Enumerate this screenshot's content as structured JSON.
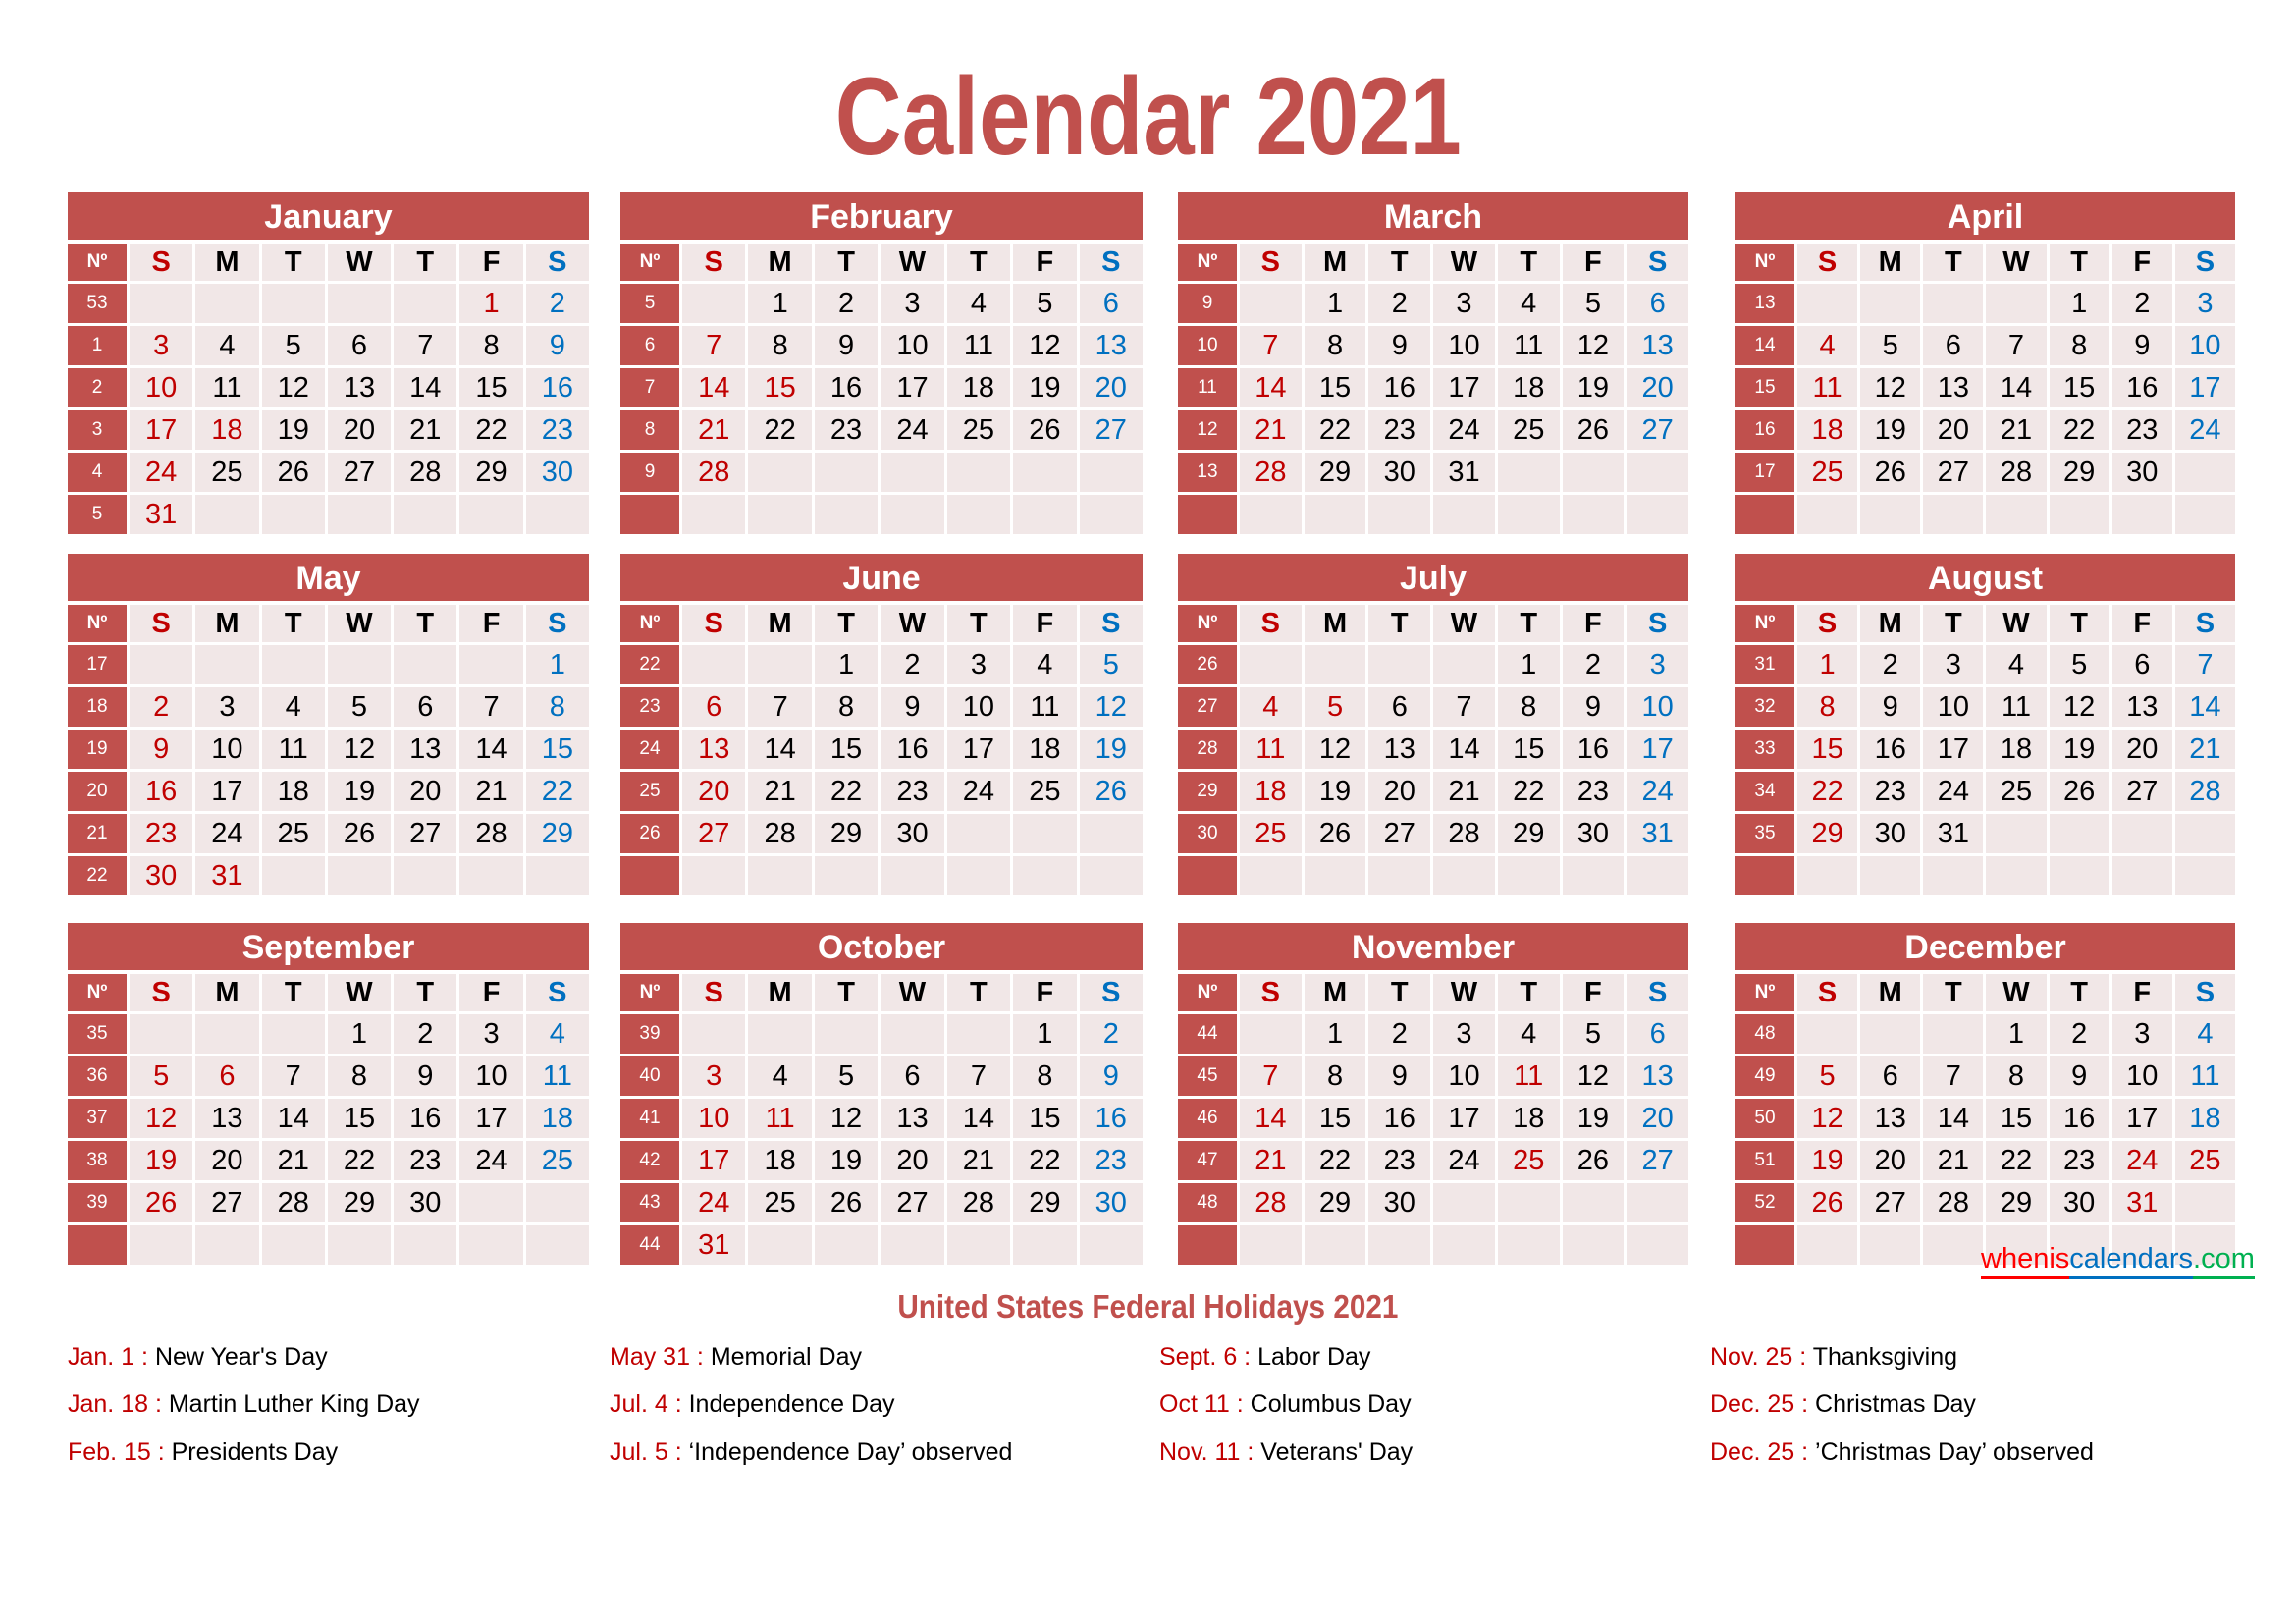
{
  "title": "Calendar 2021",
  "colors": {
    "accent": "#c0504d",
    "sunday": "#c00000",
    "saturday": "#0070c0",
    "holiday": "#c00000",
    "cell_bg": "#f1e7e7"
  },
  "week_label": "Nº",
  "weekdays": [
    "S",
    "M",
    "T",
    "W",
    "T",
    "F",
    "S"
  ],
  "months": [
    {
      "name": "January",
      "start": 5,
      "days": 31,
      "weeks": [
        "53",
        "1",
        "2",
        "3",
        "4",
        "5"
      ],
      "holidays": [
        1,
        18
      ]
    },
    {
      "name": "February",
      "start": 1,
      "days": 28,
      "weeks": [
        "5",
        "6",
        "7",
        "8",
        "9",
        ""
      ],
      "holidays": [
        15
      ]
    },
    {
      "name": "March",
      "start": 1,
      "days": 31,
      "weeks": [
        "9",
        "10",
        "11",
        "12",
        "13",
        ""
      ],
      "holidays": []
    },
    {
      "name": "April",
      "start": 4,
      "days": 30,
      "weeks": [
        "13",
        "14",
        "15",
        "16",
        "17",
        ""
      ],
      "holidays": []
    },
    {
      "name": "May",
      "start": 6,
      "days": 31,
      "weeks": [
        "17",
        "18",
        "19",
        "20",
        "21",
        "22"
      ],
      "holidays": [
        31
      ]
    },
    {
      "name": "June",
      "start": 2,
      "days": 30,
      "weeks": [
        "22",
        "23",
        "24",
        "25",
        "26",
        ""
      ],
      "holidays": []
    },
    {
      "name": "July",
      "start": 4,
      "days": 31,
      "weeks": [
        "26",
        "27",
        "28",
        "29",
        "30",
        ""
      ],
      "holidays": [
        4,
        5
      ]
    },
    {
      "name": "August",
      "start": 0,
      "days": 31,
      "weeks": [
        "31",
        "32",
        "33",
        "34",
        "35",
        ""
      ],
      "holidays": []
    },
    {
      "name": "September",
      "start": 3,
      "days": 30,
      "weeks": [
        "35",
        "36",
        "37",
        "38",
        "39",
        ""
      ],
      "holidays": [
        6
      ]
    },
    {
      "name": "October",
      "start": 5,
      "days": 31,
      "weeks": [
        "39",
        "40",
        "41",
        "42",
        "43",
        "44"
      ],
      "holidays": [
        11
      ]
    },
    {
      "name": "November",
      "start": 1,
      "days": 30,
      "weeks": [
        "44",
        "45",
        "46",
        "47",
        "48",
        ""
      ],
      "holidays": [
        11,
        25
      ]
    },
    {
      "name": "December",
      "start": 3,
      "days": 31,
      "weeks": [
        "48",
        "49",
        "50",
        "51",
        "52",
        ""
      ],
      "holidays": [
        24,
        25,
        31
      ]
    }
  ],
  "link": {
    "part1": "whenis",
    "part2": "calendars",
    "part3": ".com"
  },
  "holidays_title": "United States Federal Holidays 2021",
  "holidays": [
    [
      {
        "date": "Jan. 1 :",
        "name": " New Year's Day"
      },
      {
        "date": "Jan. 18 :",
        "name": " Martin Luther King Day"
      },
      {
        "date": "Feb. 15 :",
        "name": " Presidents Day"
      }
    ],
    [
      {
        "date": "May 31 :",
        "name": " Memorial Day"
      },
      {
        "date": "Jul. 4 :",
        "name": " Independence Day"
      },
      {
        "date": "Jul. 5 :",
        "name": " ‘Independence Day’ observed"
      }
    ],
    [
      {
        "date": "Sept. 6 :",
        "name": " Labor Day"
      },
      {
        "date": "Oct 11 :",
        "name": " Columbus Day"
      },
      {
        "date": "Nov. 11 :",
        "name": " Veterans' Day"
      }
    ],
    [
      {
        "date": "Nov. 25 :",
        "name": " Thanksgiving"
      },
      {
        "date": "Dec. 25 :",
        "name": " Christmas Day"
      },
      {
        "date": "Dec. 25 :",
        "name": " ’Christmas Day’ observed"
      }
    ]
  ]
}
